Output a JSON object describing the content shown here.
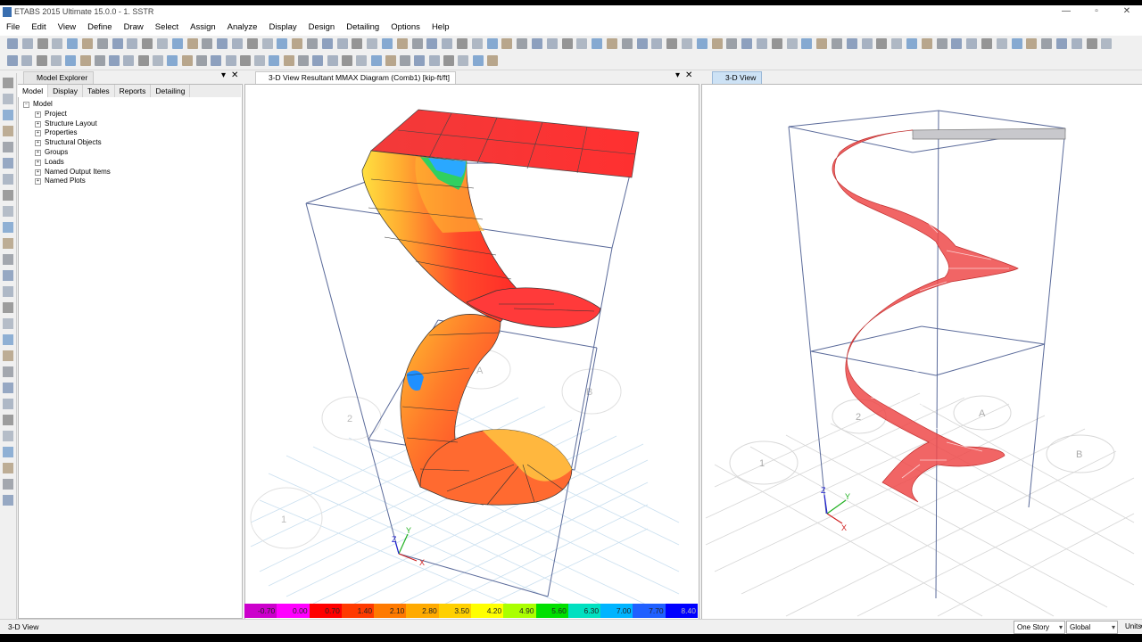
{
  "app": {
    "title": "ETABS 2015 Ultimate 15.0.0 - 1. SSTR"
  },
  "window_buttons": [
    "—",
    "▫",
    "✕"
  ],
  "menu": [
    "File",
    "Edit",
    "View",
    "Define",
    "Draw",
    "Select",
    "Assign",
    "Analyze",
    "Display",
    "Design",
    "Detailing",
    "Options",
    "Help"
  ],
  "explorer": {
    "title": "Model Explorer",
    "tabs": [
      "Model",
      "Display",
      "Tables",
      "Reports",
      "Detailing"
    ],
    "tree": {
      "root": "Model",
      "children": [
        "Project",
        "Structure Layout",
        "Properties",
        "Structural Objects",
        "Groups",
        "Loads",
        "Named Output Items",
        "Named Plots"
      ]
    }
  },
  "view1": {
    "title": "3-D View   Resultant MMAX Diagram   (Comb1)  [kip-ft/ft]"
  },
  "view2": {
    "title": "3-D View"
  },
  "grid_labels": {
    "v1": [
      "1",
      "2",
      "A",
      "B"
    ],
    "v2": [
      "1",
      "2",
      "A",
      "B"
    ]
  },
  "axis_labels": {
    "x": "X",
    "y": "Y",
    "z": "Z"
  },
  "colorbar": {
    "values": [
      "-0.70",
      "0.00",
      "0.70",
      "1.40",
      "2.10",
      "2.80",
      "3.50",
      "4.20",
      "4.90",
      "5.60",
      "6.30",
      "7.00",
      "7.70",
      "8.40"
    ],
    "colors": [
      "#cc00cc",
      "#ff00ff",
      "#ff0000",
      "#ff3a00",
      "#ff7a00",
      "#ffaa00",
      "#ffd000",
      "#ffff00",
      "#aaff00",
      "#00e000",
      "#00e0c0",
      "#00b4ff",
      "#2060ff",
      "#0000ff"
    ]
  },
  "status": {
    "text": "3-D View",
    "story": "One Story",
    "coord": "Global",
    "units": "Units..."
  }
}
